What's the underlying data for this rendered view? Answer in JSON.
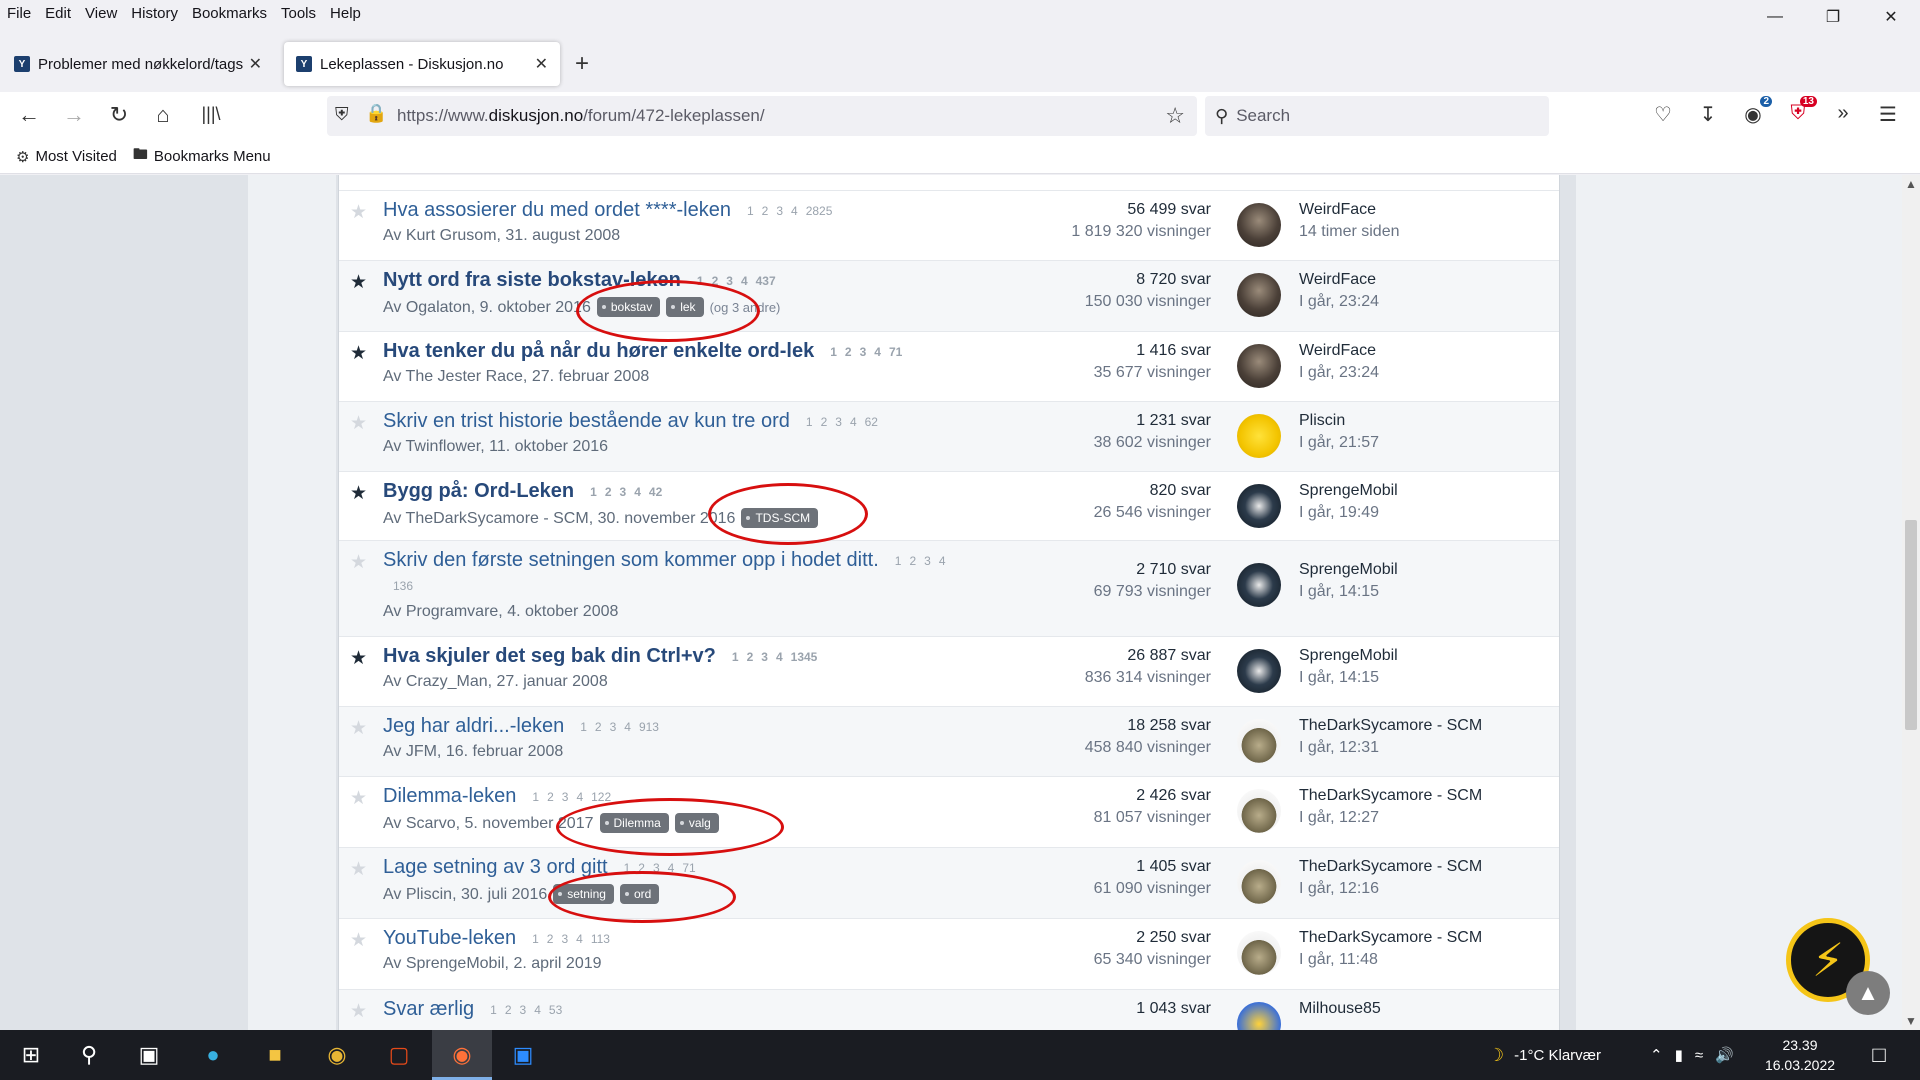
{
  "menubar": [
    "File",
    "Edit",
    "View",
    "History",
    "Bookmarks",
    "Tools",
    "Help"
  ],
  "tabs": [
    {
      "title": "Problemer med nøkkelord/tags",
      "active": false
    },
    {
      "title": "Lekeplassen - Diskusjon.no",
      "active": true
    }
  ],
  "nav": {
    "url_prefix": "https://www.",
    "url_domain": "diskusjon.no",
    "url_path": "/forum/472-lekeplassen/",
    "search_placeholder": "Search",
    "badge_1": "2",
    "badge_2": "13"
  },
  "bookmarks": [
    {
      "label": "Most Visited",
      "icon": "gear-icon"
    },
    {
      "label": "Bookmarks Menu",
      "icon": "folder-icon"
    }
  ],
  "topics": [
    {
      "title": "Hva assosierer du med ordet ****-leken",
      "bold": false,
      "starred": false,
      "pages": [
        "1",
        "2",
        "3",
        "4",
        "2825"
      ],
      "byline": "Av Kurt Grusom, 31. august 2008",
      "tags": [],
      "tag_more": "",
      "replies": "56 499 svar",
      "views": "1 819 320 visninger",
      "avatar": "av-dark",
      "last_user": "WeirdFace",
      "last_time": "14 timer siden"
    },
    {
      "title": "Nytt ord fra siste bokstav-leken",
      "bold": true,
      "starred": true,
      "pages": [
        "1",
        "2",
        "3",
        "4",
        "437"
      ],
      "byline": "Av Ogalaton, 9. oktober 2016",
      "tags": [
        "bokstav",
        "lek"
      ],
      "tag_more": "(og 3 andre)",
      "replies": "8 720 svar",
      "views": "150 030 visninger",
      "avatar": "av-dark",
      "last_user": "WeirdFace",
      "last_time": "I går, 23:24"
    },
    {
      "title": "Hva tenker du på når du hører enkelte ord-lek",
      "bold": true,
      "starred": true,
      "pages": [
        "1",
        "2",
        "3",
        "4",
        "71"
      ],
      "byline": "Av The Jester Race, 27. februar 2008",
      "tags": [],
      "tag_more": "",
      "replies": "1 416 svar",
      "views": "35 677 visninger",
      "avatar": "av-dark",
      "last_user": "WeirdFace",
      "last_time": "I går, 23:24"
    },
    {
      "title": "Skriv en trist historie bestående av kun tre ord",
      "bold": false,
      "starred": false,
      "pages": [
        "1",
        "2",
        "3",
        "4",
        "62"
      ],
      "byline": "Av Twinflower, 11. oktober 2016",
      "tags": [],
      "tag_more": "",
      "replies": "1 231 svar",
      "views": "38 602 visninger",
      "avatar": "av-yellow",
      "last_user": "Pliscin",
      "last_time": "I går, 21:57"
    },
    {
      "title": "Bygg på: Ord-Leken",
      "bold": true,
      "starred": true,
      "pages": [
        "1",
        "2",
        "3",
        "4",
        "42"
      ],
      "byline": "Av TheDarkSycamore - SCM, 30. november 2016",
      "tags": [
        "TDS-SCM"
      ],
      "tag_more": "",
      "replies": "820 svar",
      "views": "26 546 visninger",
      "avatar": "av-mobil",
      "last_user": "SprengeMobil",
      "last_time": "I går, 19:49"
    },
    {
      "title": "Skriv den første setningen som kommer opp i hodet ditt.",
      "bold": false,
      "starred": false,
      "pages": [
        "1",
        "2",
        "3",
        "4"
      ],
      "pages_line2": "136",
      "byline": "Av Programvare, 4. oktober 2008",
      "tags": [],
      "tag_more": "",
      "replies": "2 710 svar",
      "views": "69 793 visninger",
      "avatar": "av-mobil",
      "last_user": "SprengeMobil",
      "last_time": "I går, 14:15"
    },
    {
      "title": "Hva skjuler det seg bak din Ctrl+v?",
      "bold": true,
      "starred": true,
      "pages": [
        "1",
        "2",
        "3",
        "4",
        "1345"
      ],
      "byline": "Av Crazy_Man, 27. januar 2008",
      "tags": [],
      "tag_more": "",
      "replies": "26 887 svar",
      "views": "836 314 visninger",
      "avatar": "av-mobil",
      "last_user": "SprengeMobil",
      "last_time": "I går, 14:15"
    },
    {
      "title": "Jeg har aldri...-leken",
      "bold": false,
      "starred": false,
      "pages": [
        "1",
        "2",
        "3",
        "4",
        "913"
      ],
      "byline": "Av JFM, 16. februar 2008",
      "tags": [],
      "tag_more": "",
      "replies": "18 258 svar",
      "views": "458 840 visninger",
      "avatar": "av-tank",
      "last_user": "TheDarkSycamore - SCM",
      "last_time": "I går, 12:31"
    },
    {
      "title": "Dilemma-leken",
      "bold": false,
      "starred": false,
      "pages": [
        "1",
        "2",
        "3",
        "4",
        "122"
      ],
      "byline": "Av Scarvo, 5. november 2017",
      "tags": [
        "Dilemma",
        "valg"
      ],
      "tag_more": "",
      "replies": "2 426 svar",
      "views": "81 057 visninger",
      "avatar": "av-tank",
      "last_user": "TheDarkSycamore - SCM",
      "last_time": "I går, 12:27"
    },
    {
      "title": "Lage setning av 3 ord gitt",
      "bold": false,
      "starred": false,
      "pages": [
        "1",
        "2",
        "3",
        "4",
        "71"
      ],
      "byline": "Av Pliscin, 30. juli 2016",
      "tags": [
        "setning",
        "ord"
      ],
      "tag_more": "",
      "replies": "1 405 svar",
      "views": "61 090 visninger",
      "avatar": "av-tank",
      "last_user": "TheDarkSycamore - SCM",
      "last_time": "I går, 12:16"
    },
    {
      "title": "YouTube-leken",
      "bold": false,
      "starred": false,
      "pages": [
        "1",
        "2",
        "3",
        "4",
        "113"
      ],
      "byline": "Av SprengeMobil, 2. april 2019",
      "tags": [],
      "tag_more": "",
      "replies": "2 250 svar",
      "views": "65 340 visninger",
      "avatar": "av-tank",
      "last_user": "TheDarkSycamore - SCM",
      "last_time": "I går, 11:48"
    },
    {
      "title": "Svar ærlig",
      "bold": false,
      "starred": false,
      "pages": [
        "1",
        "2",
        "3",
        "4",
        "53"
      ],
      "byline": "",
      "tags": [],
      "tag_more": "",
      "replies": "1 043 svar",
      "views": "",
      "avatar": "av-simp",
      "last_user": "Milhouse85",
      "last_time": ""
    }
  ],
  "taskbar": {
    "weather": "-1°C  Klarvær",
    "time": "23.39",
    "date": "16.03.2022"
  },
  "colors": {
    "link": "#2f5f97",
    "annotation": "#d70f0f",
    "tag_bg": "#6d7279"
  }
}
